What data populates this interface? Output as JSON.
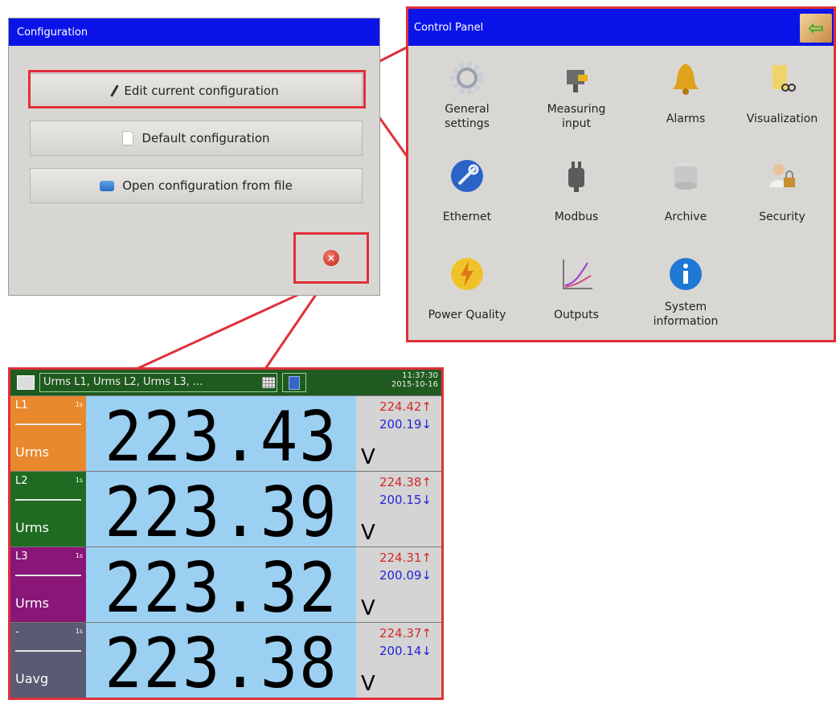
{
  "configuration": {
    "title": "Configuration",
    "buttons": [
      {
        "label": "Edit current configuration",
        "icon": "pencil-icon"
      },
      {
        "label": "Default configuration",
        "icon": "document-icon"
      },
      {
        "label": "Open configuration from file",
        "icon": "folder-icon"
      }
    ],
    "close_icon_glyph": "×"
  },
  "control_panel": {
    "title": "Control Panel",
    "back_glyph": "⇦",
    "items": [
      {
        "label": "General\nsettings",
        "icon": "gear-icon"
      },
      {
        "label": "Measuring\ninput",
        "icon": "plug-icon"
      },
      {
        "label": "Alarms",
        "icon": "bell-icon"
      },
      {
        "label": "Visualization",
        "icon": "visualization-icon"
      },
      {
        "label": "Ethernet",
        "icon": "network-icon"
      },
      {
        "label": "Modbus",
        "icon": "connector-icon"
      },
      {
        "label": "Archive",
        "icon": "database-icon"
      },
      {
        "label": "Security",
        "icon": "user-lock-icon"
      },
      {
        "label": "Power Quality",
        "icon": "lightning-icon"
      },
      {
        "label": "Outputs",
        "icon": "graph-icon"
      },
      {
        "label": "System\ninformation",
        "icon": "info-icon"
      }
    ]
  },
  "display": {
    "channel_field": "Urms L1, Urms L2, Urms L3, ...",
    "time": "11:37:30",
    "date": "2015-10-16",
    "rows": [
      {
        "channel": "L1",
        "sub": "1s",
        "quantity": "Urms",
        "value": "223.43",
        "max": "224.42↑",
        "min": "200.19↓",
        "unit": "V",
        "color": "#e8892d"
      },
      {
        "channel": "L2",
        "sub": "1s",
        "quantity": "Urms",
        "value": "223.39",
        "max": "224.38↑",
        "min": "200.15↓",
        "unit": "V",
        "color": "#1f6b22"
      },
      {
        "channel": "L3",
        "sub": "1s",
        "quantity": "Urms",
        "value": "223.32",
        "max": "224.31↑",
        "min": "200.09↓",
        "unit": "V",
        "color": "#8a1678"
      },
      {
        "channel": "-",
        "sub": "1s",
        "quantity": "Uavg",
        "value": "223.38",
        "max": "224.37↑",
        "min": "200.14↓",
        "unit": "V",
        "color": "#5a5a72"
      }
    ]
  },
  "colors": {
    "highlight": "#e0303a",
    "titlebar": "#0b14e8"
  }
}
